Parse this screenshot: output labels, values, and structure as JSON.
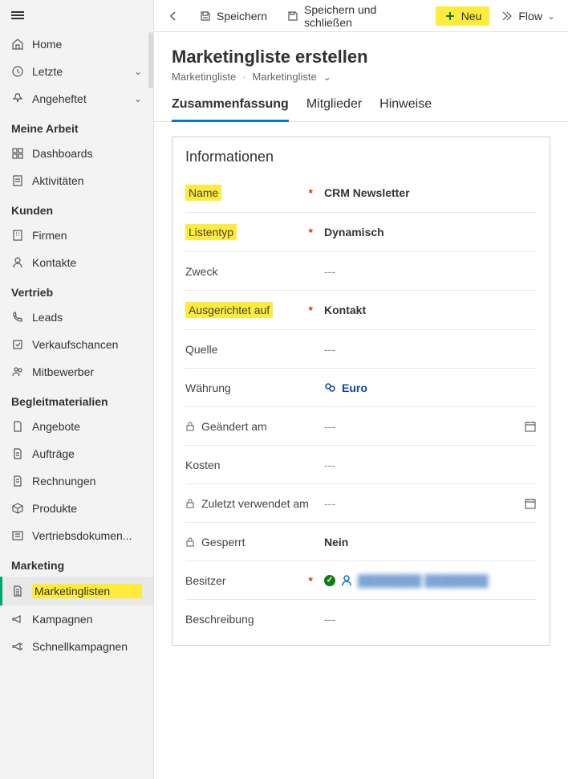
{
  "commandBar": {
    "save": "Speichern",
    "saveClose": "Speichern und schließen",
    "new": "Neu",
    "flow": "Flow"
  },
  "header": {
    "title": "Marketingliste erstellen",
    "breadcrumb1": "Marketingliste",
    "breadcrumb2": "Marketingliste"
  },
  "tabs": {
    "summary": "Zusammenfassung",
    "members": "Mitglieder",
    "notes": "Hinweise"
  },
  "card": {
    "title": "Informationen"
  },
  "fields": {
    "name": {
      "label": "Name",
      "value": "CRM Newsletter"
    },
    "listType": {
      "label": "Listentyp",
      "value": "Dynamisch"
    },
    "purpose": {
      "label": "Zweck",
      "value": "---"
    },
    "targeted": {
      "label": "Ausgerichtet auf",
      "value": "Kontakt"
    },
    "source": {
      "label": "Quelle",
      "value": "---"
    },
    "currency": {
      "label": "Währung",
      "value": "Euro"
    },
    "modified": {
      "label": "Geändert am",
      "value": "---"
    },
    "cost": {
      "label": "Kosten",
      "value": "---"
    },
    "lastUsed": {
      "label": "Zuletzt verwendet am",
      "value": "---"
    },
    "locked": {
      "label": "Gesperrt",
      "value": "Nein"
    },
    "owner": {
      "label": "Besitzer",
      "value": "████████ ████████"
    },
    "description": {
      "label": "Beschreibung",
      "value": "---"
    }
  },
  "nav": {
    "home": "Home",
    "recent": "Letzte",
    "pinned": "Angeheftet",
    "myWork": "Meine Arbeit",
    "dashboards": "Dashboards",
    "activities": "Aktivitäten",
    "customers": "Kunden",
    "accounts": "Firmen",
    "contacts": "Kontakte",
    "sales": "Vertrieb",
    "leads": "Leads",
    "opportunities": "Verkaufschancen",
    "competitors": "Mitbewerber",
    "collateral": "Begleitmaterialien",
    "quotes": "Angebote",
    "orders": "Aufträge",
    "invoices": "Rechnungen",
    "products": "Produkte",
    "salesdocs": "Vertriebsdokumen...",
    "marketing": "Marketing",
    "marketingLists": "Marketinglisten",
    "campaigns": "Kampagnen",
    "quickCampaigns": "Schnellkampagnen"
  }
}
